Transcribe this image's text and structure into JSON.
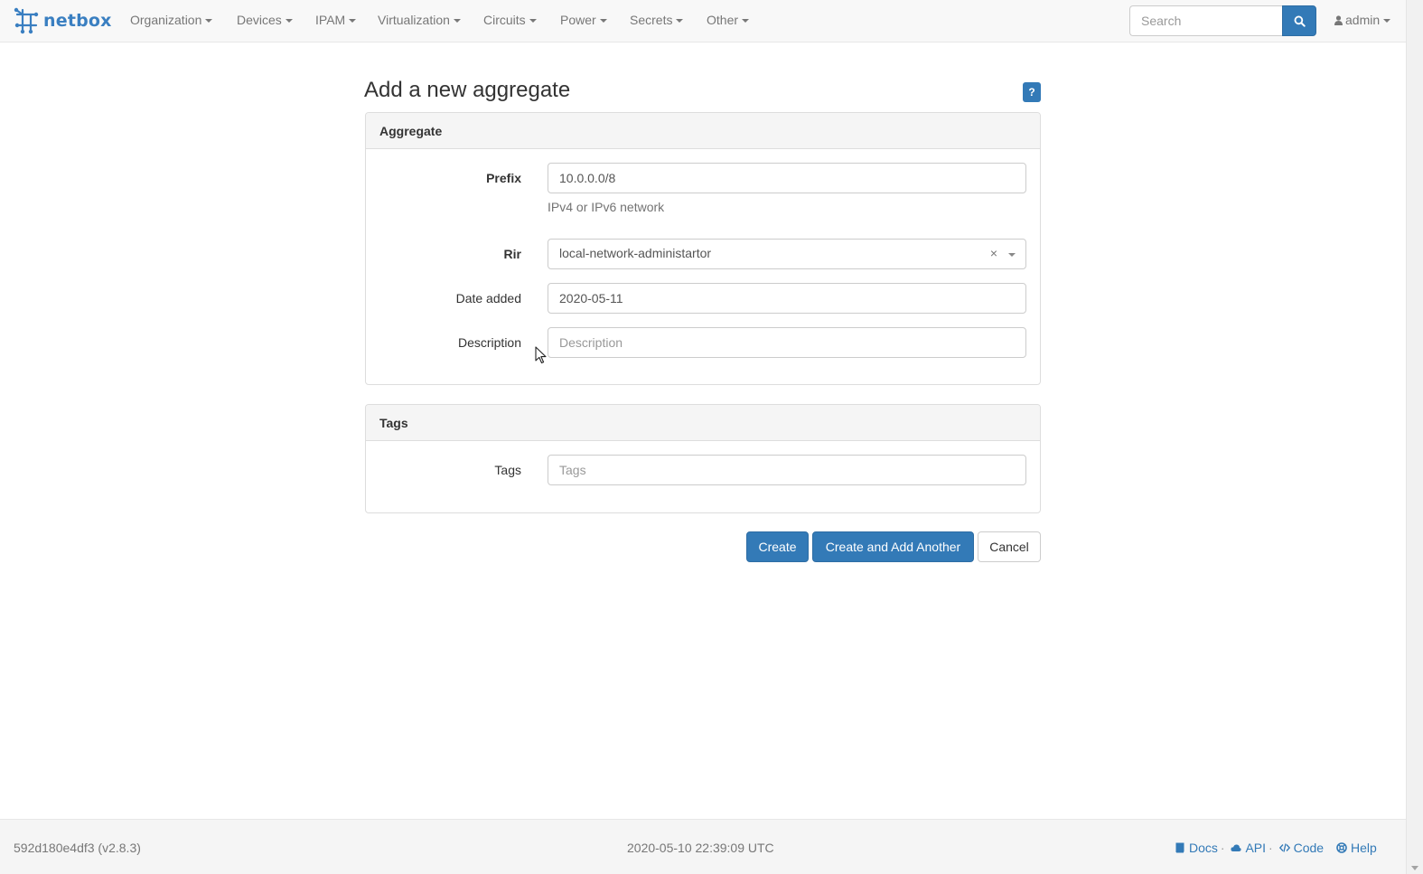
{
  "brand": {
    "name": "netbox"
  },
  "nav": {
    "items": [
      {
        "label": "Organization"
      },
      {
        "label": "Devices"
      },
      {
        "label": "IPAM"
      },
      {
        "label": "Virtualization"
      },
      {
        "label": "Circuits"
      },
      {
        "label": "Power"
      },
      {
        "label": "Secrets"
      },
      {
        "label": "Other"
      }
    ],
    "search_placeholder": "Search",
    "search_icon": "search-icon",
    "user": "admin"
  },
  "page": {
    "title": "Add a new aggregate",
    "help_label": "?"
  },
  "aggregate_panel": {
    "heading": "Aggregate",
    "prefix": {
      "label": "Prefix",
      "value": "10.0.0.0/8",
      "help": "IPv4 or IPv6 network"
    },
    "rir": {
      "label": "Rir",
      "value": "local-network-administartor",
      "clear": "×"
    },
    "date_added": {
      "label": "Date added",
      "value": "2020-05-11"
    },
    "description": {
      "label": "Description",
      "placeholder": "Description",
      "value": ""
    }
  },
  "tags_panel": {
    "heading": "Tags",
    "tags": {
      "label": "Tags",
      "placeholder": "Tags"
    }
  },
  "actions": {
    "create": "Create",
    "create_another": "Create and Add Another",
    "cancel": "Cancel"
  },
  "footer": {
    "version": "592d180e4df3 (v2.8.3)",
    "timestamp": "2020-05-10 22:39:09 UTC",
    "links": {
      "docs": "Docs",
      "api": "API",
      "code": "Code",
      "help": "Help",
      "separator": "·"
    }
  },
  "colors": {
    "primary": "#337ab7",
    "brand": "#3a7fc1",
    "navbar_bg": "#f8f8f8",
    "panel_heading_bg": "#f5f5f5"
  }
}
